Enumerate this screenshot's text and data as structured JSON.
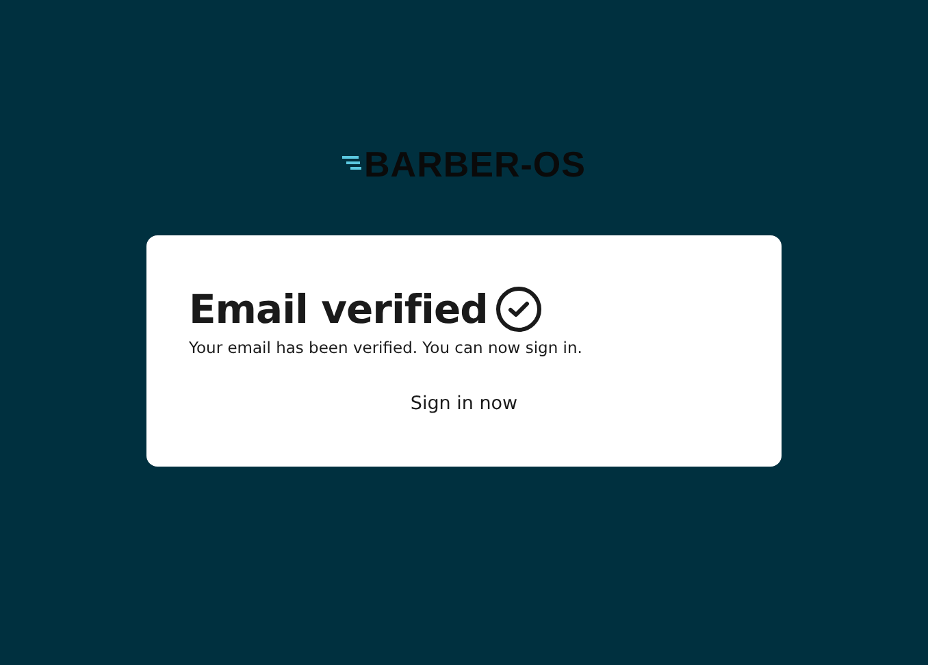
{
  "logo": {
    "text": "BARBER-OS"
  },
  "card": {
    "title": "Email verified",
    "message": "Your email has been verified. You can now sign in.",
    "link": "Sign in now"
  }
}
